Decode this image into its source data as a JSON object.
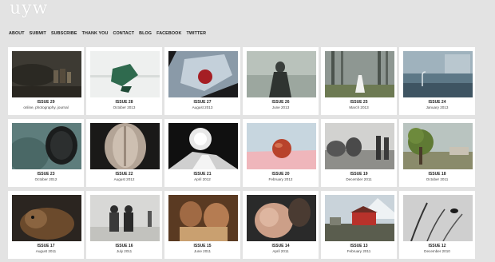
{
  "site": {
    "logo": "uyw"
  },
  "nav": [
    "ABOUT",
    "SUBMIT",
    "SUBSCRIBE",
    "THANK YOU",
    "CONTACT",
    "BLOG",
    "FACEBOOK",
    "TWITTER"
  ],
  "issues": [
    {
      "title": "ISSUE 29",
      "date": "online, photography, journal"
    },
    {
      "title": "ISSUE 28",
      "date": "October 2013"
    },
    {
      "title": "ISSUE 27",
      "date": "August 2013"
    },
    {
      "title": "ISSUE 26",
      "date": "June 2013"
    },
    {
      "title": "ISSUE 25",
      "date": "March 2013"
    },
    {
      "title": "ISSUE 24",
      "date": "January 2013"
    },
    {
      "title": "ISSUE 23",
      "date": "October 2012"
    },
    {
      "title": "ISSUE 22",
      "date": "August 2012"
    },
    {
      "title": "ISSUE 21",
      "date": "April 2012"
    },
    {
      "title": "ISSUE 20",
      "date": "February 2012"
    },
    {
      "title": "ISSUE 19",
      "date": "December 2011"
    },
    {
      "title": "ISSUE 18",
      "date": "October 2011"
    },
    {
      "title": "ISSUE 17",
      "date": "August 2011"
    },
    {
      "title": "ISSUE 16",
      "date": "July 2011"
    },
    {
      "title": "ISSUE 15",
      "date": "June 2011"
    },
    {
      "title": "ISSUE 14",
      "date": "April 2011"
    },
    {
      "title": "ISSUE 13",
      "date": "February 2011"
    },
    {
      "title": "ISSUE 12",
      "date": "December 2010"
    }
  ]
}
